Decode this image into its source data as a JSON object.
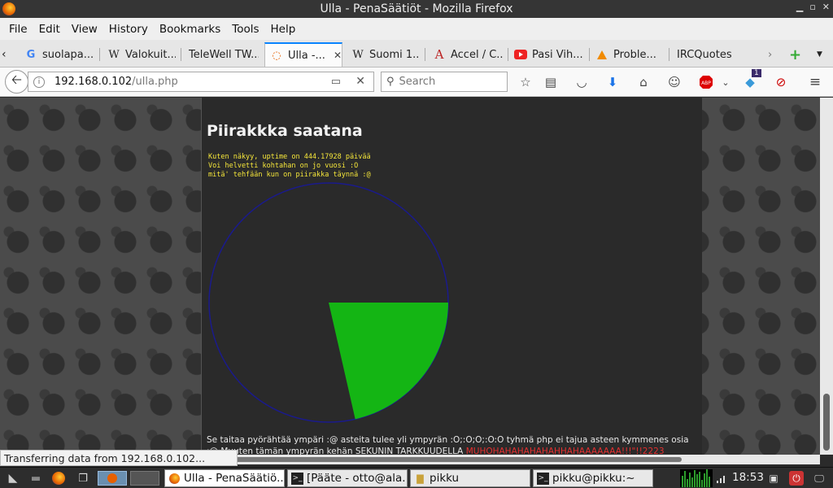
{
  "window": {
    "title": "Ulla - PenaSäätiöt - Mozilla Firefox"
  },
  "menu": [
    "File",
    "Edit",
    "View",
    "History",
    "Bookmarks",
    "Tools",
    "Help"
  ],
  "tabs": [
    {
      "label": "suolapa...",
      "icon": "google-icon"
    },
    {
      "label": "Valokuit...",
      "icon": "wikipedia-icon"
    },
    {
      "label": "TeleWell TW...",
      "icon": "none"
    },
    {
      "label": "Ulla -...",
      "icon": "loading-icon",
      "active": true
    },
    {
      "label": "Suomi 1...",
      "icon": "wikipedia-icon"
    },
    {
      "label": "Accel / C...",
      "icon": "letter-a-icon"
    },
    {
      "label": "Pasi Vih...",
      "icon": "youtube-icon"
    },
    {
      "label": "Proble...",
      "icon": "warning-icon"
    },
    {
      "label": "IRCQuotes",
      "icon": "none"
    }
  ],
  "nav": {
    "url_host": "192.168.0.102",
    "url_path": "/ulla.php",
    "search_placeholder": "Search",
    "notification_count": "1"
  },
  "page": {
    "heading": "Piirakkka saatana",
    "yellow_lines": [
      "Kuten näkyy, uptime on 444.17928 päivää",
      "Voi helvetti kohtahan on jo vuosi :O",
      "mitä' tehfään kun on piirakka täynnä :@"
    ],
    "bottom_text": "Se taitaa pyörähtää ympäri :@ asteita tulee yli ympyrän :O;:O;O;:O:O tyhmä php ei tajua asteen kymmenes osia :@ Muuten",
    "bottom_text_2": "tämän ympyrän kehän SEKUNIN TARKKUUDELLA",
    "bottom_red": "MUHOHAHAHAHAHAHHAHAAAAAAA!!!\"!!2223"
  },
  "chart_data": {
    "type": "pie",
    "fraction_filled": 0.2143,
    "fill_color": "#14b514",
    "outline_color": "#1a1a8c",
    "start_angle_deg": 0,
    "end_angle_deg": 77.15
  },
  "status": {
    "text": "Transferring data from 192.168.0.102..."
  },
  "taskbar": {
    "buttons": [
      {
        "label": "Ulla - PenaSäätiö...",
        "icon": "firefox-icon",
        "active": true
      },
      {
        "label": "[Pääte - otto@ala...",
        "icon": "terminal-icon"
      },
      {
        "label": "pikku",
        "icon": "folder-icon"
      },
      {
        "label": "pikku@pikku:~",
        "icon": "terminal-icon"
      }
    ],
    "clock": "18:53"
  }
}
